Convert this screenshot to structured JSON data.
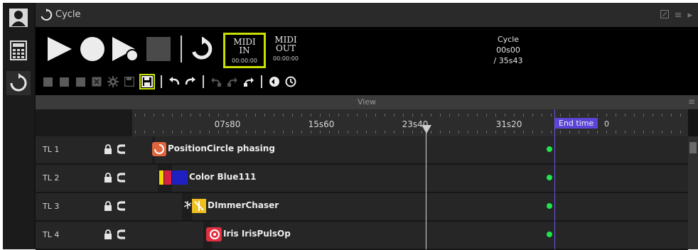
{
  "window": {
    "title": "Cycle"
  },
  "midi_in": {
    "line1": "MIDI",
    "line2": "IN",
    "timecode": "00:00:00"
  },
  "midi_out": {
    "line1": "MIDI",
    "line2": "OUT",
    "timecode": "00:00:00"
  },
  "cycle_info": {
    "name": "Cycle",
    "position": "00s00",
    "total": "/ 35s43"
  },
  "view": {
    "label": "View"
  },
  "ruler": {
    "labels": [
      "07s80",
      "15s60",
      "23s40",
      "31s20"
    ],
    "end_label": "End time",
    "end_suffix": "0"
  },
  "tracks": [
    {
      "name": "TL 1",
      "clip": "PositionCircle phasing"
    },
    {
      "name": "TL 2",
      "clip": "Color Blue111"
    },
    {
      "name": "TL 3",
      "clip": "DImmerChaser"
    },
    {
      "name": "TL 4",
      "clip": "Iris IrisPulsOp"
    }
  ],
  "colors": {
    "midi_in_highlight": "#c8e000",
    "end_time": "#5b45d6",
    "active_dot": "#1ee64a",
    "position_clip": "#e0643c",
    "color_yellow": "#f0d800",
    "color_red": "#d82040",
    "color_blue": "#2020c0",
    "dimmer_clip": "#f0c020",
    "iris_clip": "#e03040"
  }
}
